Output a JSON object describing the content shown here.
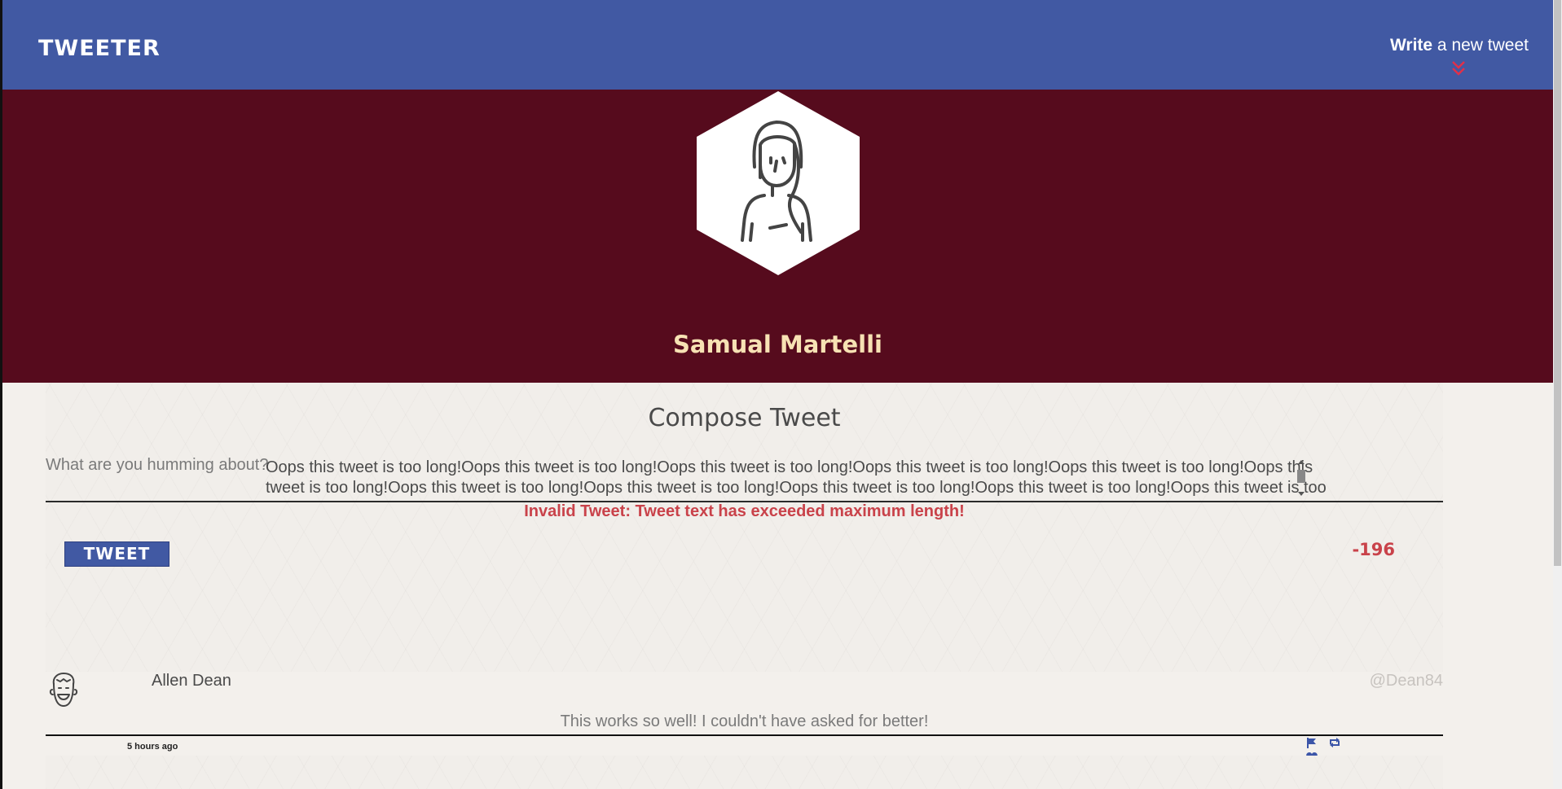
{
  "nav": {
    "brand": "TWEETER",
    "compose_bold": "Write",
    "compose_rest": " a new tweet"
  },
  "profile": {
    "name": "Samual Martelli"
  },
  "compose": {
    "title": "Compose Tweet",
    "prompt": "What are you humming about?",
    "text_value": "Oops this tweet is too long!Oops this tweet is too long!Oops this tweet is too long!Oops this tweet is too long!Oops this tweet is too long!Oops this tweet is too long!Oops this tweet is too long!Oops this tweet is too long!Oops this tweet is too long!Oops this tweet is too long!Oops this tweet is too long!Oops this tweet is",
    "error": "Invalid Tweet: Tweet text has exceeded maximum length!",
    "button_label": "TWEET",
    "counter": "-196"
  },
  "tweets": [
    {
      "name": "Allen Dean",
      "handle": "@Dean84",
      "body": "This works so well! I couldn't have asked for better!",
      "time": "5 hours ago",
      "actions": [
        "flag-icon",
        "retweet-icon",
        "heart-icon"
      ]
    }
  ],
  "colors": {
    "nav": "#4159a3",
    "profile_bg": "#560b1d",
    "name": "#f7e2b4",
    "error": "#c9424a",
    "accent_chevron": "#e0304a"
  }
}
